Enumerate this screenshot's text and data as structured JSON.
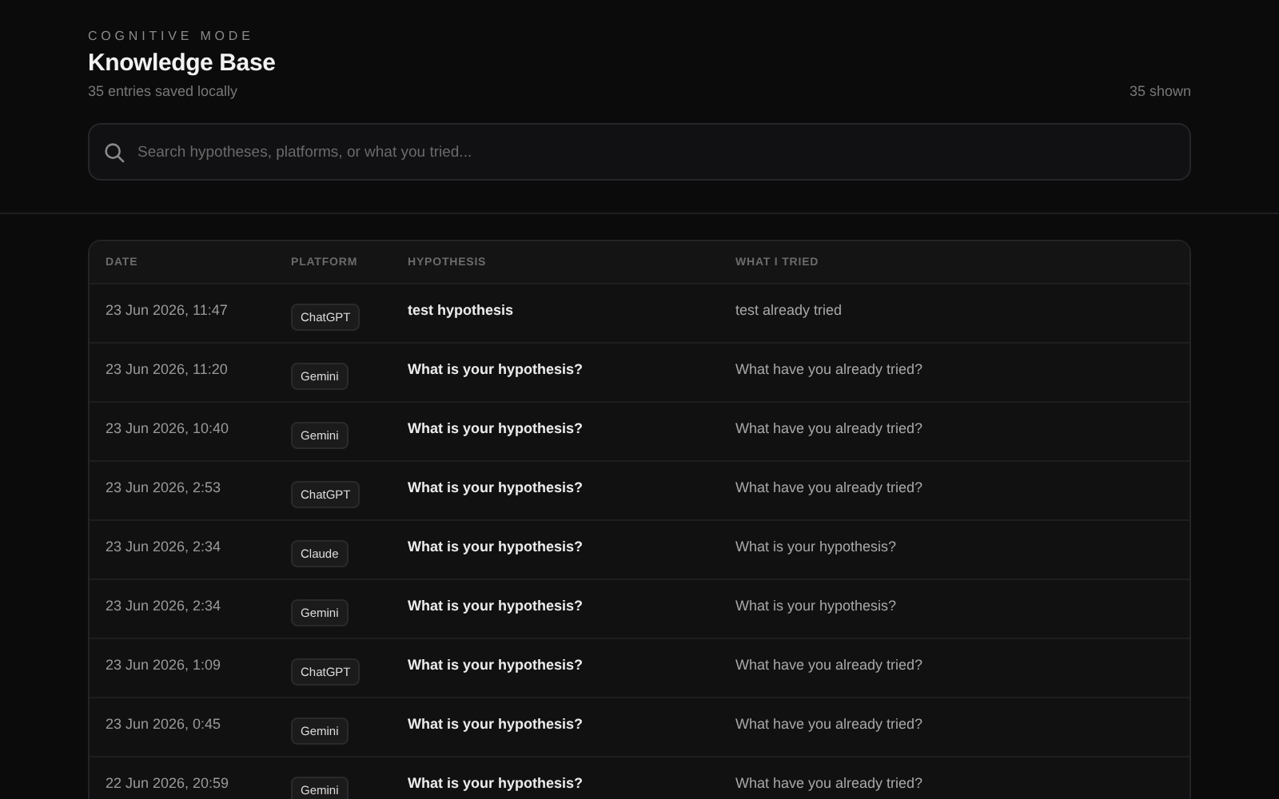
{
  "header": {
    "eyebrow": "COGNITIVE MODE",
    "title": "Knowledge Base",
    "subtitle": "35 entries saved locally",
    "count": "35 shown"
  },
  "search": {
    "placeholder": "Search hypotheses, platforms, or what you tried..."
  },
  "table": {
    "columns": [
      "DATE",
      "PLATFORM",
      "HYPOTHESIS",
      "WHAT I TRIED"
    ],
    "rows": [
      {
        "date": "23 Jun 2026, 11:47",
        "platform": "ChatGPT",
        "hypothesis": "test hypothesis",
        "tried": "test already tried"
      },
      {
        "date": "23 Jun 2026, 11:20",
        "platform": "Gemini",
        "hypothesis": "What is your hypothesis?",
        "tried": "What have you already tried?"
      },
      {
        "date": "23 Jun 2026, 10:40",
        "platform": "Gemini",
        "hypothesis": "What is your hypothesis?",
        "tried": "What have you already tried?"
      },
      {
        "date": "23 Jun 2026, 2:53",
        "platform": "ChatGPT",
        "hypothesis": "What is your hypothesis?",
        "tried": "What have you already tried?"
      },
      {
        "date": "23 Jun 2026, 2:34",
        "platform": "Claude",
        "hypothesis": "What is your hypothesis?",
        "tried": "What is your hypothesis?"
      },
      {
        "date": "23 Jun 2026, 2:34",
        "platform": "Gemini",
        "hypothesis": "What is your hypothesis?",
        "tried": "What is your hypothesis?"
      },
      {
        "date": "23 Jun 2026, 1:09",
        "platform": "ChatGPT",
        "hypothesis": "What is your hypothesis?",
        "tried": "What have you already tried?"
      },
      {
        "date": "23 Jun 2026, 0:45",
        "platform": "Gemini",
        "hypothesis": "What is your hypothesis?",
        "tried": "What have you already tried?"
      },
      {
        "date": "22 Jun 2026, 20:59",
        "platform": "Gemini",
        "hypothesis": "What is your hypothesis?",
        "tried": "What have you already tried?"
      }
    ]
  }
}
